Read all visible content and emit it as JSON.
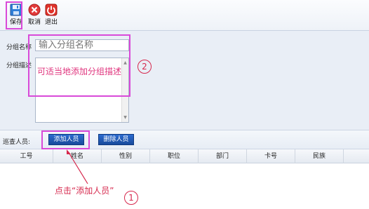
{
  "toolbar": {
    "save_label": "保存",
    "cancel_label": "取消",
    "exit_label": "退出"
  },
  "form": {
    "name_label": "分组名称",
    "name_placeholder": "输入分组名称",
    "desc_label": "分组描述",
    "desc_placeholder": "可适当地添加分组描述"
  },
  "members": {
    "label": "巡查人员:",
    "add_button": "添加人员",
    "remove_button": "删除人员"
  },
  "table": {
    "columns": [
      "工号",
      "姓名",
      "性别",
      "职位",
      "部门",
      "卡号",
      "民族"
    ]
  },
  "annotations": {
    "callout_1": "点击“添加人员”",
    "marker_1": "1",
    "marker_2": "2"
  },
  "colors": {
    "highlight": "#d94ad9",
    "annotation": "#d6284d",
    "button_blue": "#1f57b4"
  }
}
